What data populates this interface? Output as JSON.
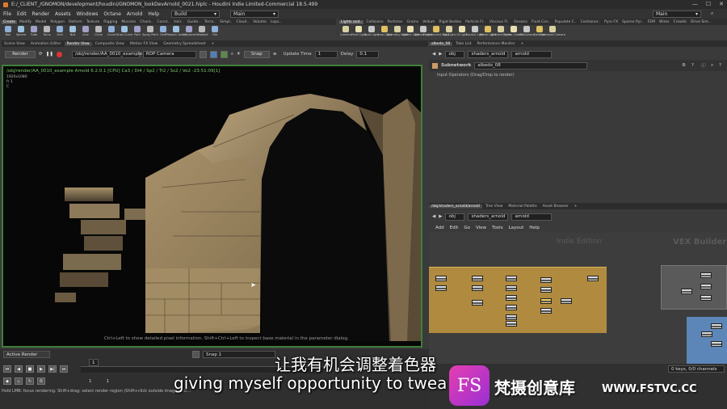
{
  "window": {
    "title": "E:/_CLIENT_/GNOMON/development/houdini/GNOMON_lookDevArnold_0021.hiplc - Houdini Indie Limited-Commercial 18.5.499"
  },
  "menu": {
    "items": [
      "File",
      "Edit",
      "Render",
      "Assets",
      "Windows",
      "Octane",
      "Arnold",
      "Help"
    ],
    "build_label": "Build",
    "main_label": "Main",
    "main_label_right": "Main"
  },
  "shelf_tabs_left": [
    "Create",
    "Modify",
    "Model",
    "Polygon",
    "Deform",
    "Texture",
    "Rigging",
    "Muscles",
    "Chara..",
    "Const..",
    "Hair..",
    "Guide..",
    "Terra..",
    "Simpl..",
    "Cloud..",
    "Volume",
    "Lops.."
  ],
  "shelf_tabs_right": [
    "Lights and..",
    "Collisions",
    "Particles",
    "Grains",
    "Vellum",
    "Rigid Bodies",
    "Particle Fl..",
    "Viscous Fl..",
    "Oceans",
    "Fluid Con..",
    "Populate C..",
    "Container..",
    "Pyro FX",
    "Sparse Pyr..",
    "FEM",
    "Wires",
    "Crowds",
    "Drive Sim.."
  ],
  "tools_left": [
    "Box",
    "Sphere",
    "Tube",
    "Torus",
    "Grid",
    "Null",
    "Line",
    "Circle",
    "Curve",
    "Draw Curve",
    "Path",
    "Spray Paint",
    "Font",
    "Platonic Solids",
    "L-System",
    "Metaball",
    "File"
  ],
  "tools_right": [
    "Camera",
    "Point Light",
    "Spot Light",
    "Area Light",
    "Geometry Light",
    "Volume Light",
    "Distant Light",
    "Environment Light",
    "Sky Light",
    "GI Light",
    "Caustic Light",
    "Portal Light",
    "Ambient Light",
    "Stereo Camera",
    "VR Camera",
    "Switcher",
    "Gamepad Camera"
  ],
  "left_pane_tabs": [
    "Scene View",
    "Animation Editor",
    "Render View",
    "Composite View",
    "Motion FX View",
    "Geometry Spreadsheet"
  ],
  "render_toolbar": {
    "render_btn": "Render",
    "path": "/obj/render/AA_0010_example",
    "camera": "ROP Camera",
    "snap": "Snap",
    "update_time_label": "Update Time",
    "update_time_value": "1",
    "delay_label": "Delay",
    "delay_value": "0.1"
  },
  "viewport": {
    "header": "/obj/render/AA_0010_example  Arnold 6.2.0.1 [CPU] Ca3 / Di4 / Sp2 / Tr2 / Ss2 / Vo2 -23:51:09[1]",
    "resolution": "1920x1080",
    "line2": "fr 1",
    "line3": "C",
    "hint": "Ctrl+Left to show detailed pixel information. Shift+Ctrl+Left to inspect base material in the parameter dialog."
  },
  "right_top": {
    "tabs": [
      "albedo_08",
      "Take List",
      "Performance Monitor"
    ],
    "path_parts": [
      "obj",
      "shaders_arnold",
      "arnold"
    ],
    "node_type": "Subnetwork",
    "node_name": "albedo_08",
    "input_operators": "Input Operators (Drag/Drop to render)"
  },
  "right_bottom": {
    "tabs": [
      "/obj/shaders_arnold/arnold",
      "Tree View",
      "Material Palette",
      "Asset Browser"
    ],
    "path_parts": [
      "obj",
      "shaders_arnold",
      "arnold"
    ],
    "menu": [
      "Add",
      "Edit",
      "Go",
      "View",
      "Tools",
      "Layout",
      "Help"
    ],
    "watermark_left": "Indie Edition",
    "watermark_right": "VEX Builder"
  },
  "timeline": {
    "active_render": "Active Render",
    "snap_label": "Snap",
    "snap_value": "1",
    "frame": "1",
    "start": "1",
    "end": "1",
    "keys": "0 keys, 0/0 channels"
  },
  "status": {
    "text": "Hold LMB: focus rendering. Shift+drag: select render region (Shift+click outside image to cl..."
  },
  "subtitles": {
    "cn": "让我有机会调整着色器",
    "en": "giving myself opportunity to twea"
  },
  "brand": {
    "logo": "FS",
    "cn": "梵摄创意库",
    "url": "WWW.FSTVC.CC"
  }
}
